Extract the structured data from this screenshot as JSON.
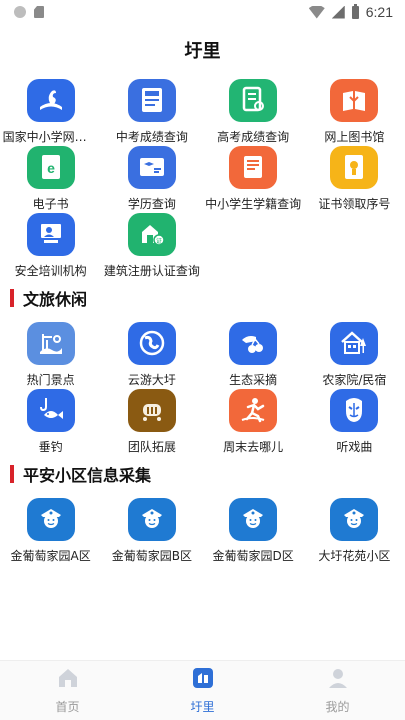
{
  "status_bar": {
    "time": "6:21"
  },
  "header": {
    "title": "圩里"
  },
  "services": [
    {
      "label": "国家中小学网络云平台",
      "icon": "swan-book-icon",
      "color": "#2f6be6"
    },
    {
      "label": "中考成绩查询",
      "icon": "score-card-icon",
      "color": "#3a6fe0"
    },
    {
      "label": "高考成绩查询",
      "icon": "document-search-icon",
      "color": "#22b573"
    },
    {
      "label": "网上图书馆",
      "icon": "open-book-icon",
      "color": "#f2683a"
    },
    {
      "label": "电子书",
      "icon": "ebook-icon",
      "color": "#21b36f"
    },
    {
      "label": "学历查询",
      "icon": "id-card-icon",
      "color": "#3a6fe0"
    },
    {
      "label": "中小学生学籍查询",
      "icon": "student-record-icon",
      "color": "#f2683a"
    },
    {
      "label": "证书领取序号",
      "icon": "certificate-icon",
      "color": "#f6b418"
    },
    {
      "label": "安全培训机构",
      "icon": "training-board-icon",
      "color": "#2f6be6"
    },
    {
      "label": "建筑注册认证查询",
      "icon": "building-cert-icon",
      "color": "#21b36f"
    }
  ],
  "sections": [
    {
      "title": "文旅休闲",
      "items": [
        {
          "label": "热门景点",
          "icon": "attraction-icon",
          "color": "#5b8fe0"
        },
        {
          "label": "云游大圩",
          "icon": "globe-icon",
          "color": "#2f6be6"
        },
        {
          "label": "生态采摘",
          "icon": "fruit-picking-icon",
          "color": "#2f6be6"
        },
        {
          "label": "农家院/民宿",
          "icon": "farmhouse-icon",
          "color": "#2f6be6"
        },
        {
          "label": "垂钓",
          "icon": "fishing-icon",
          "color": "#2f6be6"
        },
        {
          "label": "团队拓展",
          "icon": "team-building-icon",
          "color": "#8a5a12"
        },
        {
          "label": "周末去哪儿",
          "icon": "weekend-runner-icon",
          "color": "#f2683a"
        },
        {
          "label": "听戏曲",
          "icon": "opera-mask-icon",
          "color": "#2f6be6"
        }
      ]
    },
    {
      "title": "平安小区信息采集",
      "items": [
        {
          "label": "金葡萄家园A区",
          "icon": "police-officer-icon",
          "color": "#1f7ad2"
        },
        {
          "label": "金葡萄家园B区",
          "icon": "police-officer-icon",
          "color": "#1f7ad2"
        },
        {
          "label": "金葡萄家园D区",
          "icon": "police-officer-icon",
          "color": "#1f7ad2"
        },
        {
          "label": "大圩花苑小区",
          "icon": "police-officer-icon",
          "color": "#1f7ad2"
        }
      ]
    }
  ],
  "bottom_nav": [
    {
      "label": "首页",
      "icon": "home-icon",
      "active": false
    },
    {
      "label": "圩里",
      "icon": "village-icon",
      "active": true
    },
    {
      "label": "我的",
      "icon": "profile-icon",
      "active": false
    }
  ]
}
